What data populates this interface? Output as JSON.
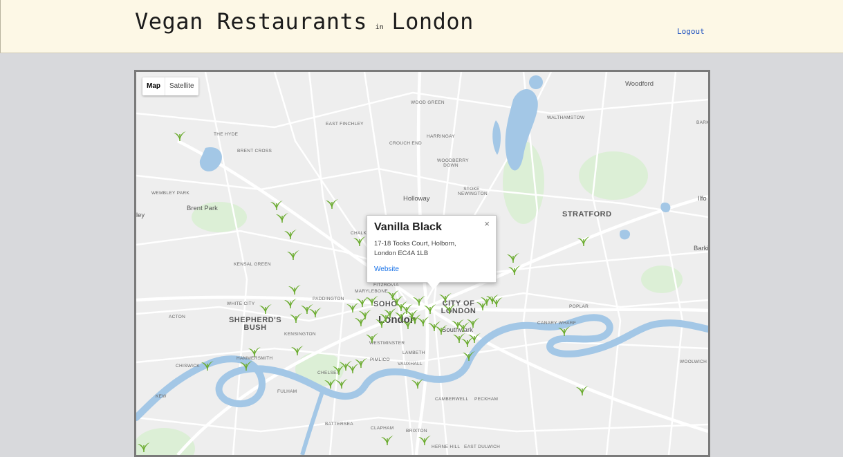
{
  "header": {
    "title_main": "Vegan Restaurants",
    "title_in": "in",
    "title_city": "London",
    "logout_label": "Logout"
  },
  "map": {
    "type_controls": {
      "map_label": "Map",
      "satellite_label": "Satellite",
      "selected": "Map"
    },
    "info_window": {
      "name": "Vanilla Black",
      "address_line1": "17-18 Tooks Court, Holborn,",
      "address_line2": "London EC4A 1LB",
      "link_label": "Website",
      "close_symbol": "×"
    },
    "places": {
      "woodford": "Woodford",
      "wood_green": "WOOD GREEN",
      "east_finchley": "EAST FINCHLEY",
      "walthamstow": "WALTHAMSTOW",
      "the_hyde": "THE HYDE",
      "harringay": "HARRINGAY",
      "crouch_end": "CROUCH END",
      "brent_cross": "BRENT CROSS",
      "woodberry_down": "WOODBERRY DOWN",
      "wembley_park": "WEMBLEY PARK",
      "brent_park": "Brent Park",
      "holloway": "Holloway",
      "stoke_newington": "STOKE NEWINGTON",
      "stratford": "STRATFORD",
      "ilford": "Ilfo",
      "barking": "Barki",
      "kensal_green": "KENSAL GREEN",
      "chalk": "CHALK",
      "paddington": "PADDINGTON",
      "fitzrovia": "FITZROVIA",
      "marylebone": "MARYLEBONE",
      "soho": "SOHO",
      "city_of_london": "CITY OF LONDON",
      "london": "London",
      "poplar": "POPLAR",
      "white_city": "WHITE CITY",
      "acton": "ACTON",
      "shepherds_bush": "SHEPHERD'S BUSH",
      "kensington": "KENSINGTON",
      "westminster": "WESTMINSTER",
      "southwark": "Southwark",
      "canary_wharf": "CANARY WHARF",
      "lambeth": "LAMBETH",
      "hammersmith": "HAMMERSMITH",
      "chiswick": "CHISWICK",
      "pimlico": "PIMLICO",
      "vauxhall": "VAUXHALL",
      "woolwich": "WOOLWICH",
      "chelsea": "CHELSEA",
      "kew": "KEW",
      "fulham": "FULHAM",
      "camberwell": "CAMBERWELL",
      "peckham": "PECKHAM",
      "battersea": "BATTERSEA",
      "clapham": "CLAPHAM",
      "brixton": "BRIXTON",
      "herne_hill": "HERNE HILL",
      "east_dulwich": "EAST DULWICH",
      "bark": "BARK",
      "ley": "ley"
    },
    "marker_icon": "vegan-leaf-icon",
    "marker_color": "#6aab2e",
    "water_color": "#a3c7e6",
    "park_color": "#d7ecd1"
  }
}
